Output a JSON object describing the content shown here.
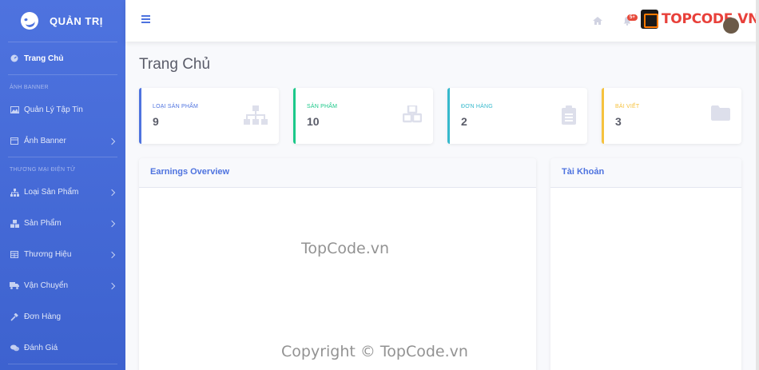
{
  "sidebar": {
    "brand": "QUẢN TRỊ",
    "active_item": "Trang Chủ",
    "headings": [
      "ẢNH BANNER",
      "THƯƠNG MẠI ĐIỆN TỬ"
    ],
    "items": [
      {
        "label": "Quản Lý Tập Tin",
        "icon": "image-icon",
        "has_children": false
      },
      {
        "label": "Ảnh Banner",
        "icon": "window-icon",
        "has_children": true
      },
      {
        "label": "Loại Sản Phẩm",
        "icon": "sitemap-icon",
        "has_children": true
      },
      {
        "label": "Sản Phẩm",
        "icon": "cubes-icon",
        "has_children": true
      },
      {
        "label": "Thương Hiệu",
        "icon": "table-icon",
        "has_children": true
      },
      {
        "label": "Vận Chuyển",
        "icon": "truck-icon",
        "has_children": true
      },
      {
        "label": "Đơn Hàng",
        "icon": "hammer-icon",
        "has_children": false
      },
      {
        "label": "Đánh Giá",
        "icon": "comments-icon",
        "has_children": false
      }
    ]
  },
  "topbar": {
    "notification_count": "5+",
    "logo_text": "TOPCODE.VN"
  },
  "main": {
    "page_title": "Trang Chủ",
    "stats": [
      {
        "label": "LOẠI SẢN PHẨM",
        "value": "9",
        "color": "#4e73df",
        "icon": "sitemap-icon"
      },
      {
        "label": "SẢN PHẨM",
        "value": "10",
        "color": "#1cc88a",
        "icon": "cubes-icon"
      },
      {
        "label": "ĐƠN HÀNG",
        "value": "2",
        "color": "#36b9cc",
        "icon": "clipboard-icon"
      },
      {
        "label": "BÀI VIẾT",
        "value": "3",
        "color": "#f6c23e",
        "icon": "folder-icon"
      }
    ],
    "earnings_title": "Earnings Overview",
    "accounts_title": "Tài Khoản"
  },
  "watermarks": {
    "center": "TopCode.vn",
    "copyright": "Copyright © TopCode.vn"
  }
}
